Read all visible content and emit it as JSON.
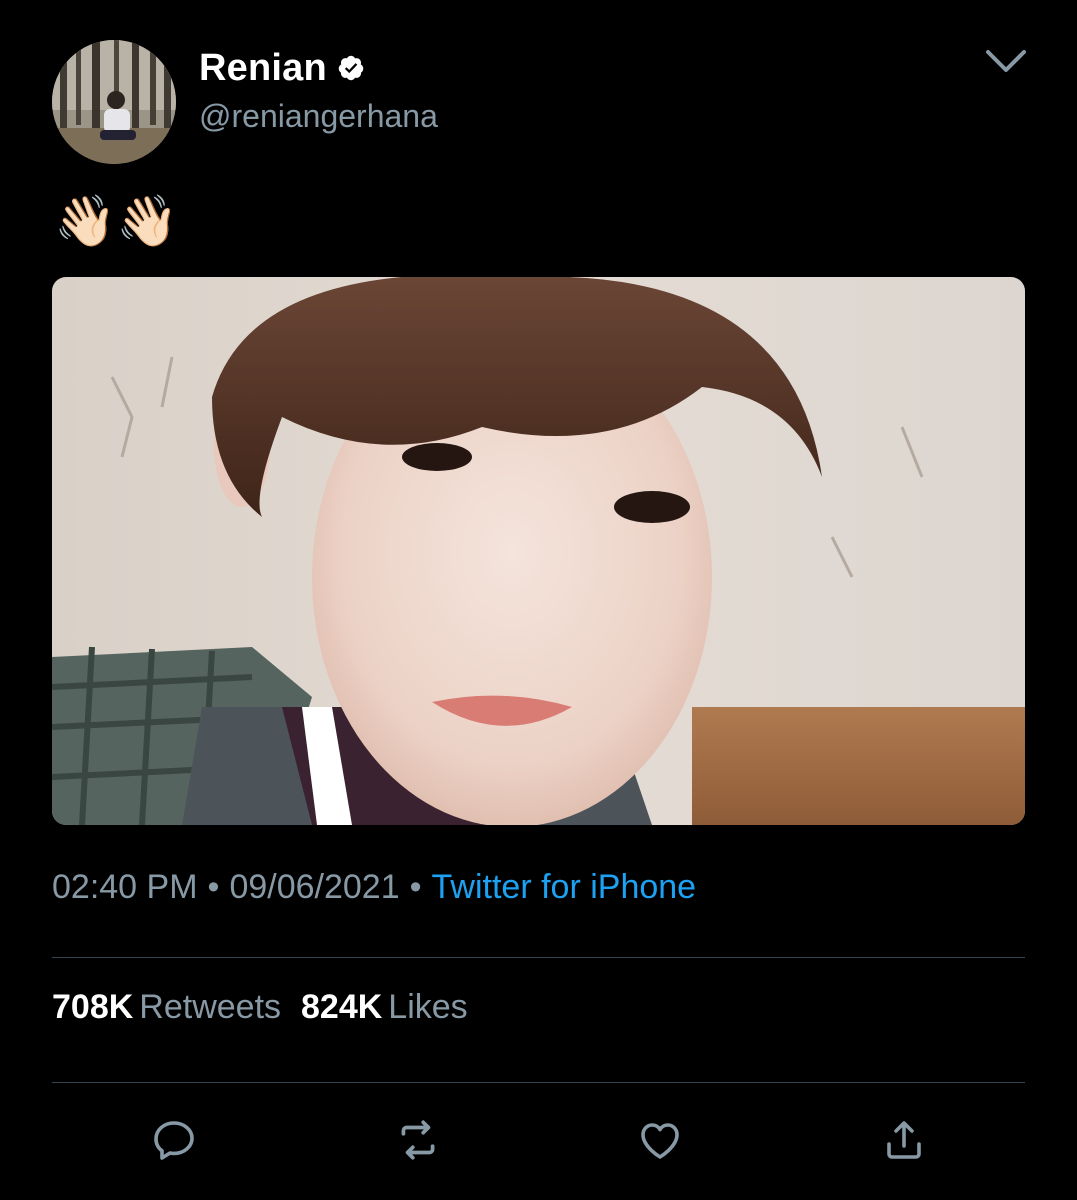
{
  "tweet": {
    "display_name": "Renian",
    "handle": "@reniangerhana",
    "verified": true,
    "text": "👋🏻👋🏻",
    "time": "02:40 PM",
    "date": "09/06/2021",
    "separator": "•",
    "source": "Twitter for iPhone",
    "retweets_count": "708K",
    "retweets_label": "Retweets",
    "likes_count": "824K",
    "likes_label": "Likes"
  },
  "icons": {
    "verified": "verified-badge-icon",
    "menu": "chevron-down-icon",
    "reply": "reply-icon",
    "retweet": "retweet-icon",
    "like": "heart-icon",
    "share": "share-icon"
  },
  "colors": {
    "background": "#000000",
    "text_primary": "#ffffff",
    "text_secondary": "#8899a6",
    "link": "#1da1f2",
    "divider": "#38444d"
  }
}
